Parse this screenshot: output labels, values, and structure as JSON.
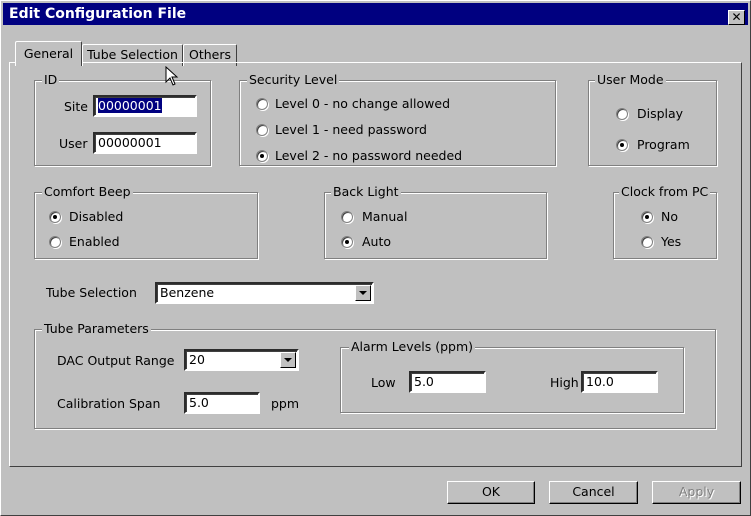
{
  "window": {
    "title": "Edit Configuration File",
    "close_glyph": "✕"
  },
  "tabs": [
    {
      "label": "General",
      "active": true
    },
    {
      "label": "Tube Selection",
      "active": false
    },
    {
      "label": "Others",
      "active": false
    }
  ],
  "id_group": {
    "legend": "ID",
    "site_label": "Site",
    "site_value": "00000001",
    "user_label": "User",
    "user_value": "00000001"
  },
  "security_level": {
    "legend": "Security Level",
    "options": [
      {
        "label": "Level 0 - no change allowed",
        "selected": false
      },
      {
        "label": "Level 1 - need password",
        "selected": false
      },
      {
        "label": "Level 2 - no password needed",
        "selected": true
      }
    ]
  },
  "user_mode": {
    "legend": "User Mode",
    "options": [
      {
        "label": "Display",
        "selected": false
      },
      {
        "label": "Program",
        "selected": true
      }
    ]
  },
  "comfort_beep": {
    "legend": "Comfort Beep",
    "options": [
      {
        "label": "Disabled",
        "selected": true
      },
      {
        "label": "Enabled",
        "selected": false
      }
    ]
  },
  "back_light": {
    "legend": "Back Light",
    "options": [
      {
        "label": "Manual",
        "selected": false
      },
      {
        "label": "Auto",
        "selected": true
      }
    ]
  },
  "clock_from_pc": {
    "legend": "Clock from PC",
    "options": [
      {
        "label": "No",
        "selected": true
      },
      {
        "label": "Yes",
        "selected": false
      }
    ]
  },
  "tube_selection": {
    "label": "Tube Selection",
    "value": "Benzene"
  },
  "tube_parameters": {
    "legend": "Tube Parameters",
    "dac_label": "DAC Output Range",
    "dac_value": "20",
    "cal_label": "Calibration Span",
    "cal_value": "5.0",
    "cal_unit": "ppm"
  },
  "alarm_levels": {
    "legend": "Alarm Levels (ppm)",
    "low_label": "Low",
    "low_value": "5.0",
    "high_label": "High",
    "high_value": "10.0"
  },
  "buttons": {
    "ok": "OK",
    "cancel": "Cancel",
    "apply": "Apply"
  },
  "colors": {
    "titlebar": "#000080",
    "face": "#c0c0c0",
    "selection": "#000080"
  }
}
